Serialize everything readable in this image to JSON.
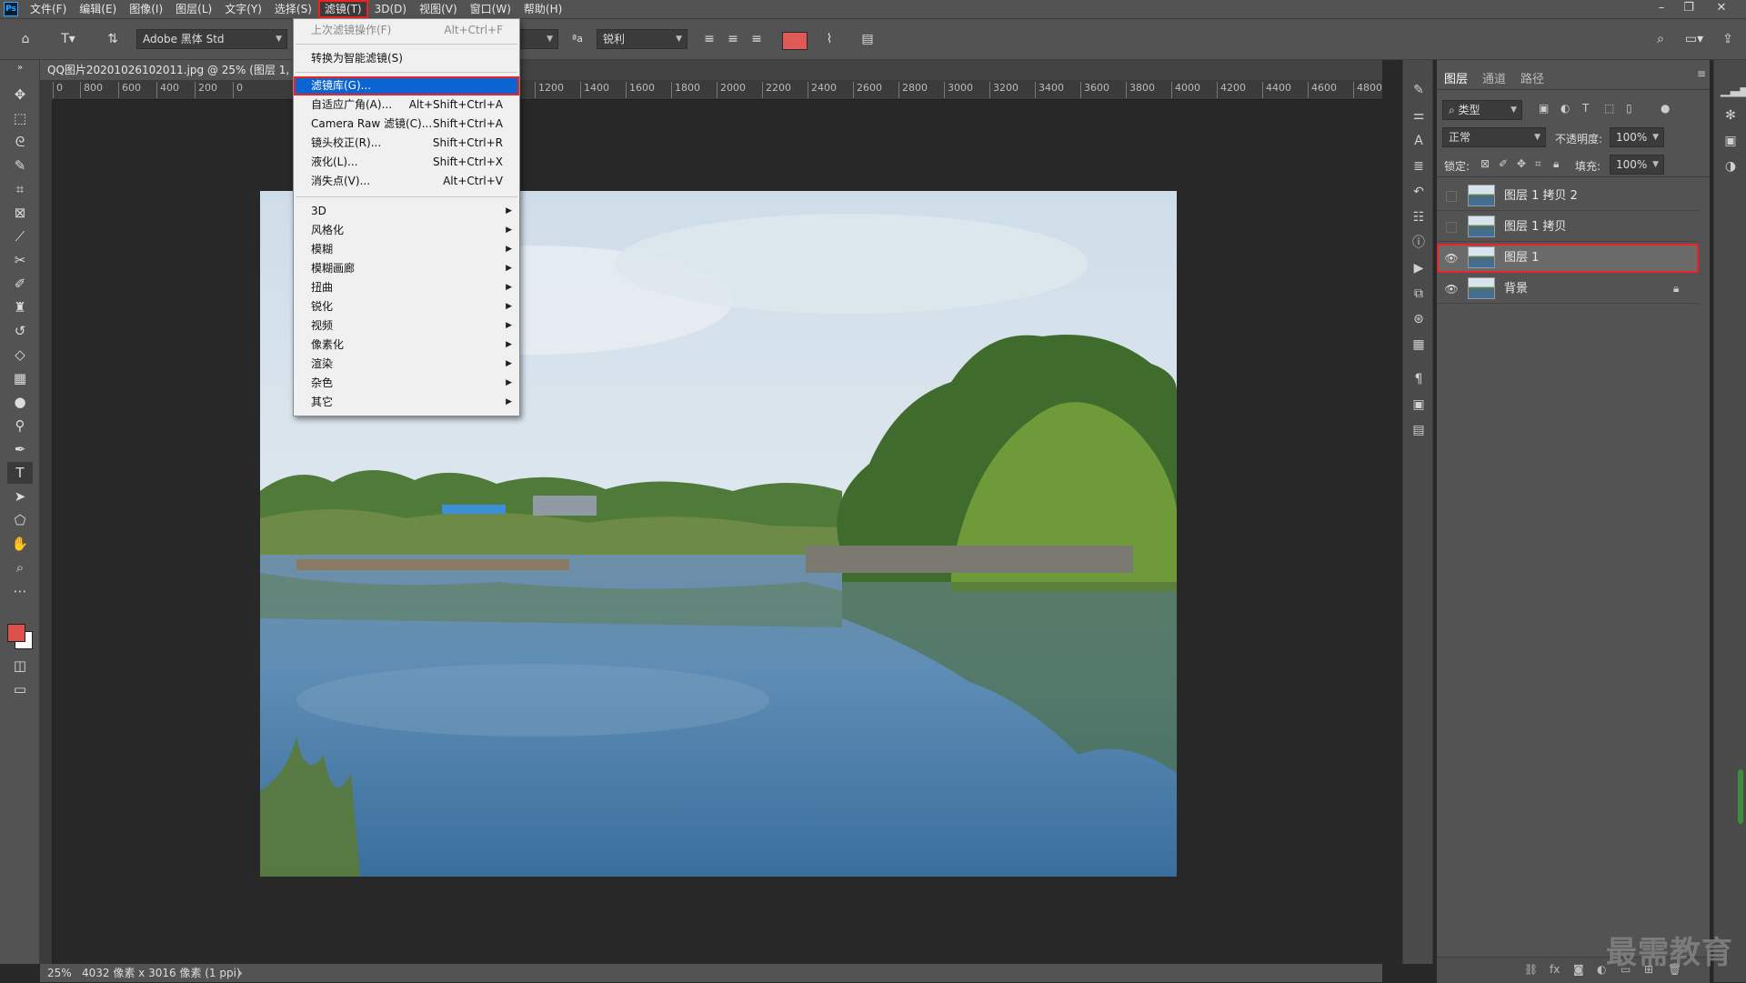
{
  "app": {
    "logo": "Ps"
  },
  "menubar": {
    "items": [
      "文件(F)",
      "编辑(E)",
      "图像(I)",
      "图层(L)",
      "文字(Y)",
      "选择(S)",
      "滤镜(T)",
      "3D(D)",
      "视图(V)",
      "窗口(W)",
      "帮助(H)"
    ],
    "active": "滤镜(T)"
  },
  "options": {
    "font_family": "Adobe 黑体 Std",
    "antialias": "锐利",
    "text_color": "#e05a55"
  },
  "document": {
    "tab_title": "QQ图片20201026102011.jpg @ 25% (图层 1, RGB/8)"
  },
  "ruler": {
    "ticks": [
      "0",
      "800",
      "600",
      "400",
      "200",
      "0",
      "1200",
      "1400",
      "1600",
      "1800",
      "2000",
      "2200",
      "2400",
      "2600",
      "2800",
      "3000",
      "3200",
      "3400",
      "3600",
      "3800",
      "4000",
      "4200",
      "4400",
      "4600",
      "4800"
    ]
  },
  "filter_menu": {
    "items": [
      {
        "label": "上次滤镜操作(F)",
        "shortcut": "Alt+Ctrl+F",
        "disabled": true
      },
      {
        "label": "转换为智能滤镜(S)",
        "shortcut": ""
      },
      {
        "label": "滤镜库(G)...",
        "shortcut": "",
        "highlighted": true
      },
      {
        "label": "自适应广角(A)...",
        "shortcut": "Alt+Shift+Ctrl+A"
      },
      {
        "label": "Camera Raw 滤镜(C)...",
        "shortcut": "Shift+Ctrl+A"
      },
      {
        "label": "镜头校正(R)...",
        "shortcut": "Shift+Ctrl+R"
      },
      {
        "label": "液化(L)...",
        "shortcut": "Shift+Ctrl+X"
      },
      {
        "label": "消失点(V)...",
        "shortcut": "Alt+Ctrl+V"
      }
    ],
    "submenus": [
      "3D",
      "风格化",
      "模糊",
      "模糊画廊",
      "扭曲",
      "锐化",
      "视频",
      "像素化",
      "渲染",
      "杂色",
      "其它"
    ]
  },
  "layers_panel": {
    "tabs": [
      "图层",
      "通道",
      "路径"
    ],
    "active_tab": "图层",
    "filter_kind": "类型",
    "blend_mode": "正常",
    "opacity_label": "不透明度:",
    "opacity": "100%",
    "lock_label": "锁定:",
    "fill_label": "填充:",
    "fill": "100%",
    "layers": [
      {
        "name": "图层 1 拷贝 2",
        "visible": false,
        "selected": false,
        "locked": false
      },
      {
        "name": "图层 1 拷贝",
        "visible": false,
        "selected": false,
        "locked": false
      },
      {
        "name": "图层 1",
        "visible": true,
        "selected": true,
        "locked": false
      },
      {
        "name": "背景",
        "visible": true,
        "selected": false,
        "locked": true
      }
    ]
  },
  "status": {
    "zoom": "25%",
    "doc_size": "4032 像素 x 3016 像素 (1 ppi)"
  },
  "watermark": "最需教育"
}
